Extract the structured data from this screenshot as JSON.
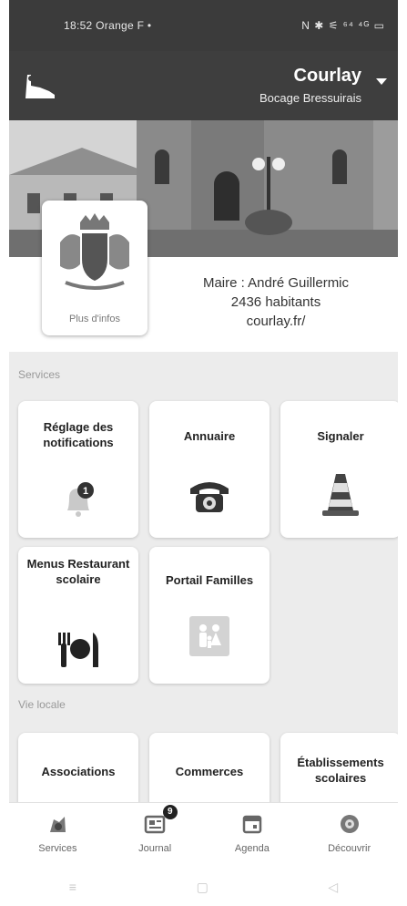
{
  "status_bar": {
    "time_carrier": "18:52  Orange F  •",
    "icons": "N ✱ ⚟ ⁶⁴ ⁴ᴳ ▭"
  },
  "app_bar": {
    "city": "Courlay",
    "subtitle": "Bocage Bressuirais",
    "logo_icon": "map-region-icon",
    "dropdown_icon": "caret-down-icon"
  },
  "commune": {
    "more_info": "Plus d'infos",
    "mayor": "Maire : André Guillermic",
    "inhabitants": "2436 habitants",
    "website": "courlay.fr/"
  },
  "sections": {
    "services": "Services",
    "vie_locale": "Vie locale"
  },
  "services_tiles": [
    {
      "label": "Réglage des notifications",
      "icon": "bell-icon",
      "badge": "1"
    },
    {
      "label": "Annuaire",
      "icon": "telephone-icon"
    },
    {
      "label": "Signaler",
      "icon": "traffic-cone-icon"
    },
    {
      "label": "Menus Restaurant scolaire",
      "icon": "fork-plate-knife-icon"
    },
    {
      "label": "Portail Familles",
      "icon": "family-icon"
    }
  ],
  "vie_locale_tiles": [
    {
      "label": "Associations"
    },
    {
      "label": "Commerces"
    },
    {
      "label": "Établissements scolaires"
    }
  ],
  "bottom_nav": [
    {
      "label": "Services",
      "icon": "services-icon"
    },
    {
      "label": "Journal",
      "icon": "newspaper-icon",
      "badge": "9"
    },
    {
      "label": "Agenda",
      "icon": "calendar-icon"
    },
    {
      "label": "Découvrir",
      "icon": "discover-icon"
    }
  ],
  "system_nav": {
    "recent": "≡",
    "home": "▢",
    "back": "◁"
  },
  "colors": {
    "app_bar": "#3e3e3e",
    "content_bg": "#ececec",
    "tile_bg": "#ffffff"
  }
}
